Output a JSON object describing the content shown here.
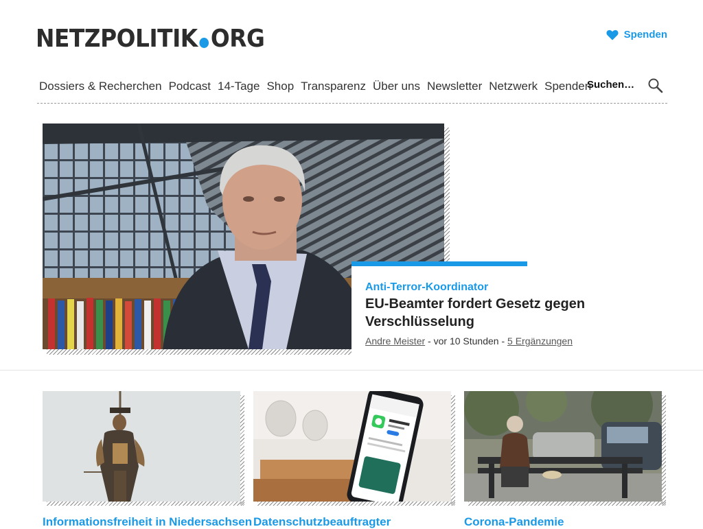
{
  "header": {
    "logo_left": "NETZPOLITIK",
    "logo_right": "ORG",
    "donate_label": "Spenden",
    "accent": "#1a9ae6"
  },
  "nav": {
    "items": [
      "Dossiers & Recherchen",
      "Podcast",
      "14-Tage",
      "Shop",
      "Transparenz",
      "Über uns",
      "Newsletter",
      "Netzwerk",
      "Spenden"
    ],
    "search_placeholder": "Suchen…"
  },
  "hero": {
    "kicker": "Anti-Terror-Koordinator",
    "title": "EU-Beamter fordert Gesetz gegen Verschlüsselung",
    "author": "Andre Meister",
    "sep1": " - ",
    "time": "vor 10 Stunden",
    "sep2": " - ",
    "comments": "5 Ergänzungen"
  },
  "cards": [
    {
      "kicker": "Informationsfreiheit in Niedersachsen"
    },
    {
      "kicker": "Datenschutzbeauftragter"
    },
    {
      "kicker": "Corona-Pandemie"
    }
  ],
  "icons": [
    "heart-icon",
    "search-icon"
  ]
}
